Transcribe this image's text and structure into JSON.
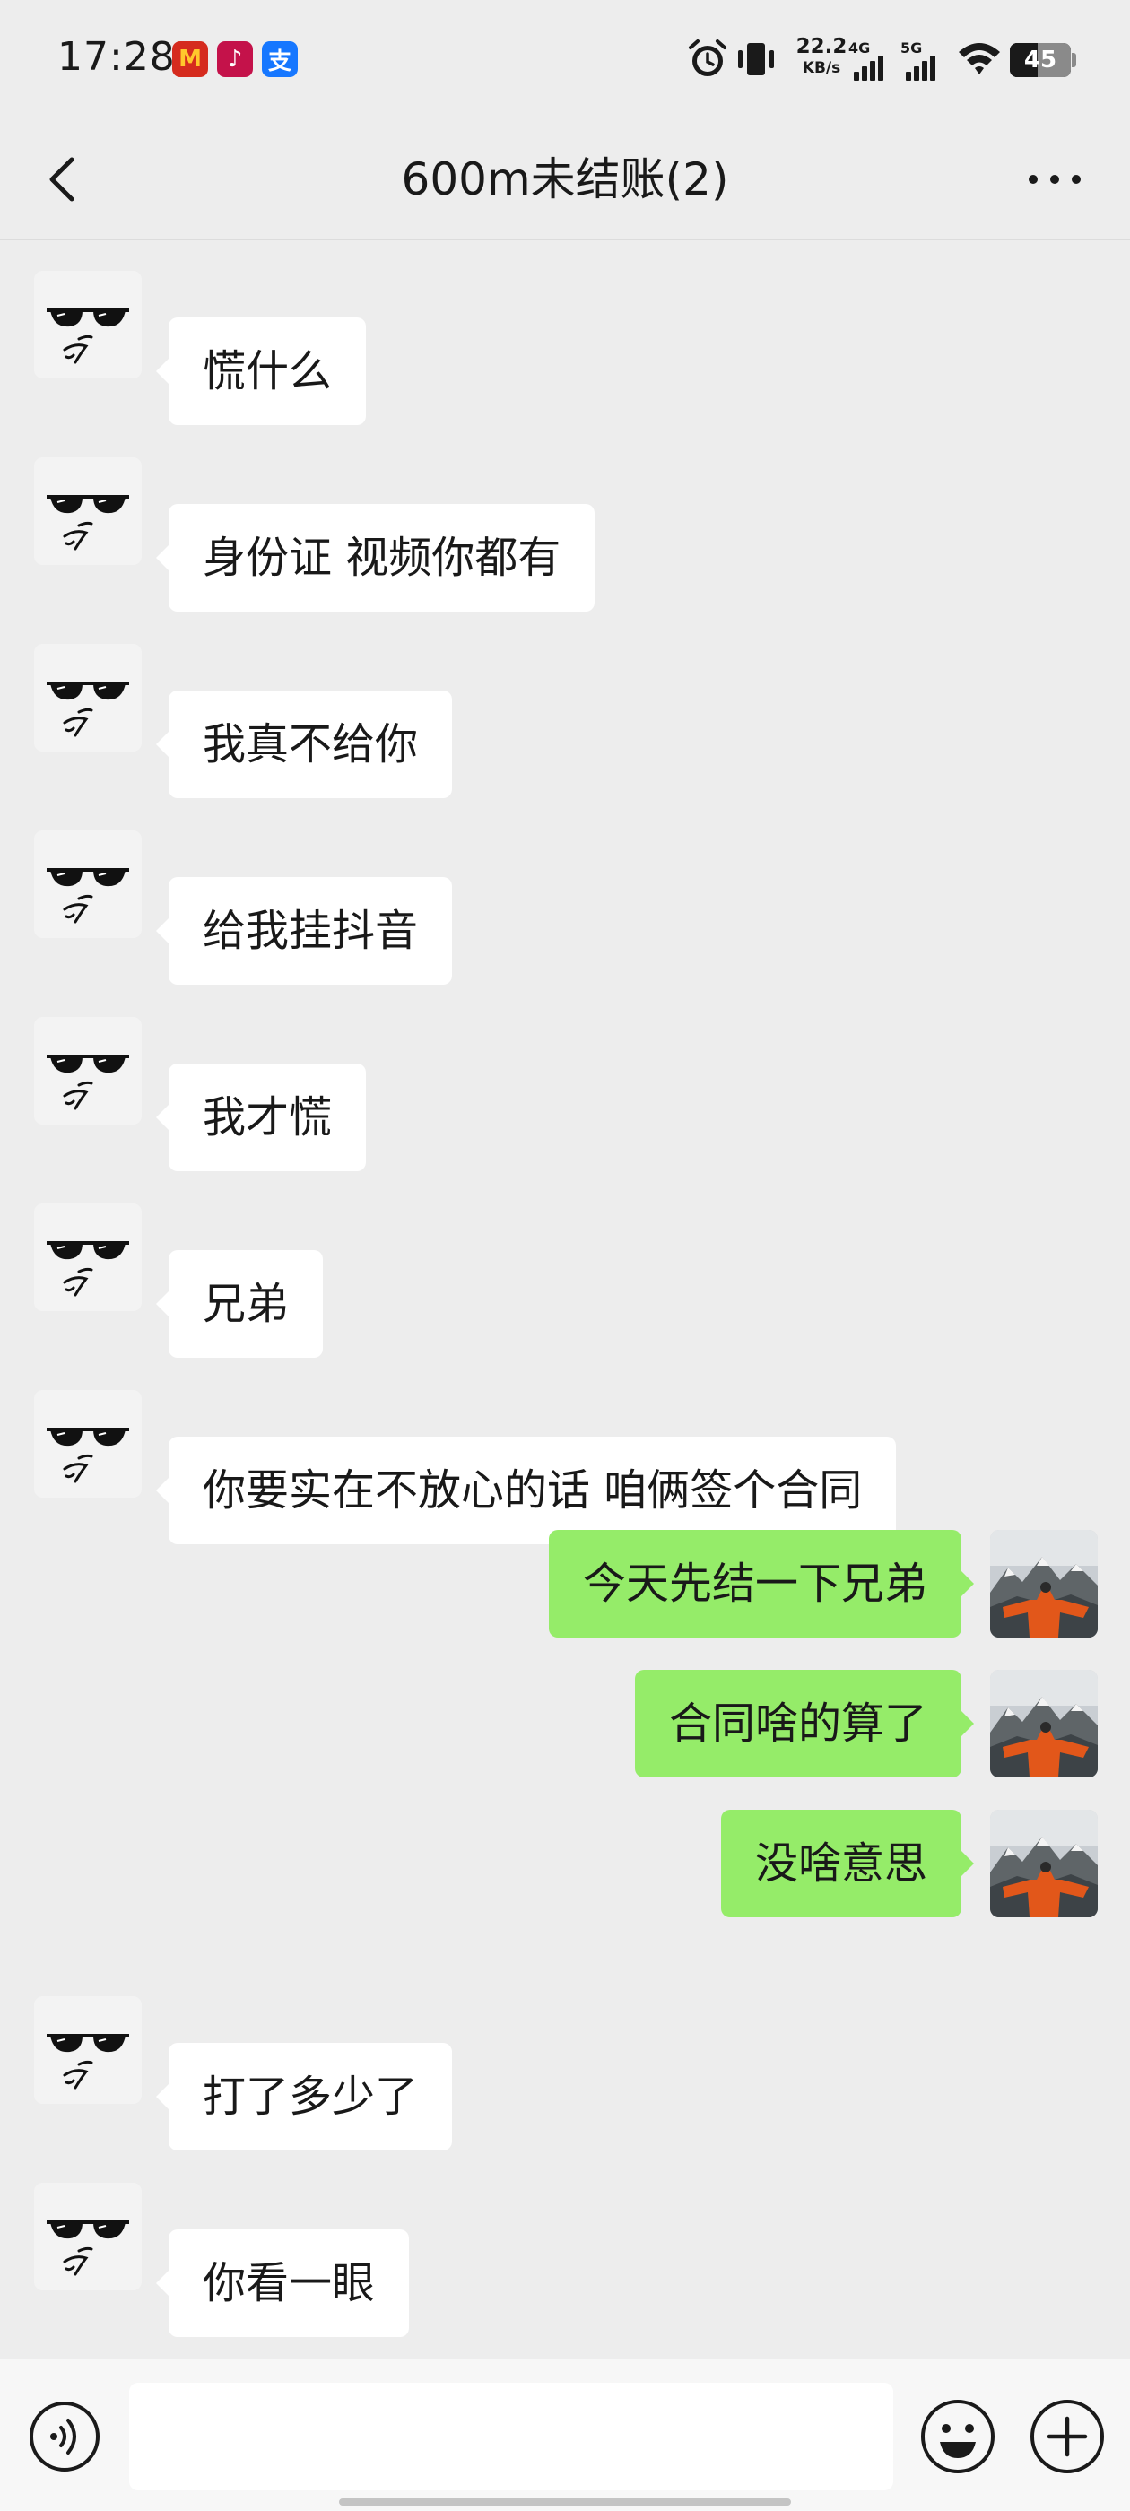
{
  "status_bar": {
    "time": "17:28",
    "app_badges": [
      {
        "name": "mcdonalds-app-icon",
        "glyph": "M",
        "color": "#d52b1e"
      },
      {
        "name": "tiktok-app-icon",
        "glyph": "♪",
        "color": "#c4124a"
      },
      {
        "name": "alipay-app-icon",
        "glyph": "支",
        "color": "#1677ff"
      }
    ],
    "net_speed_value": "22.2",
    "net_speed_unit": "KB/s",
    "signal_4g_label": "4G",
    "signal_5g_label": "5G",
    "battery_level": "45"
  },
  "header": {
    "title": "600m未结账(2)",
    "back_icon": "chevron-left-icon",
    "more_icon": "more-icon"
  },
  "messages": [
    {
      "side": "left",
      "text": "慌什么"
    },
    {
      "side": "left",
      "text": "身份证 视频你都有"
    },
    {
      "side": "left",
      "text": "我真不给你"
    },
    {
      "side": "left",
      "text": "给我挂抖音"
    },
    {
      "side": "left",
      "text": "我才慌"
    },
    {
      "side": "left",
      "text": "兄弟"
    },
    {
      "side": "left",
      "text": "你要实在不放心的话 咱俩签个合同"
    },
    {
      "side": "right",
      "text": "今天先结一下兄弟"
    },
    {
      "side": "right",
      "text": "合同啥的算了"
    },
    {
      "side": "right",
      "text": "没啥意思"
    },
    {
      "side": "left",
      "text": "打了多少了"
    },
    {
      "side": "left",
      "text": "你看一眼"
    }
  ],
  "input_bar": {
    "placeholder": "",
    "voice_icon": "voice-icon",
    "emoji_icon": "emoji-icon",
    "plus_icon": "plus-icon"
  },
  "colors": {
    "background": "#ededed",
    "bubble_incoming": "#ffffff",
    "bubble_outgoing": "#95ec69",
    "text": "#191919"
  }
}
